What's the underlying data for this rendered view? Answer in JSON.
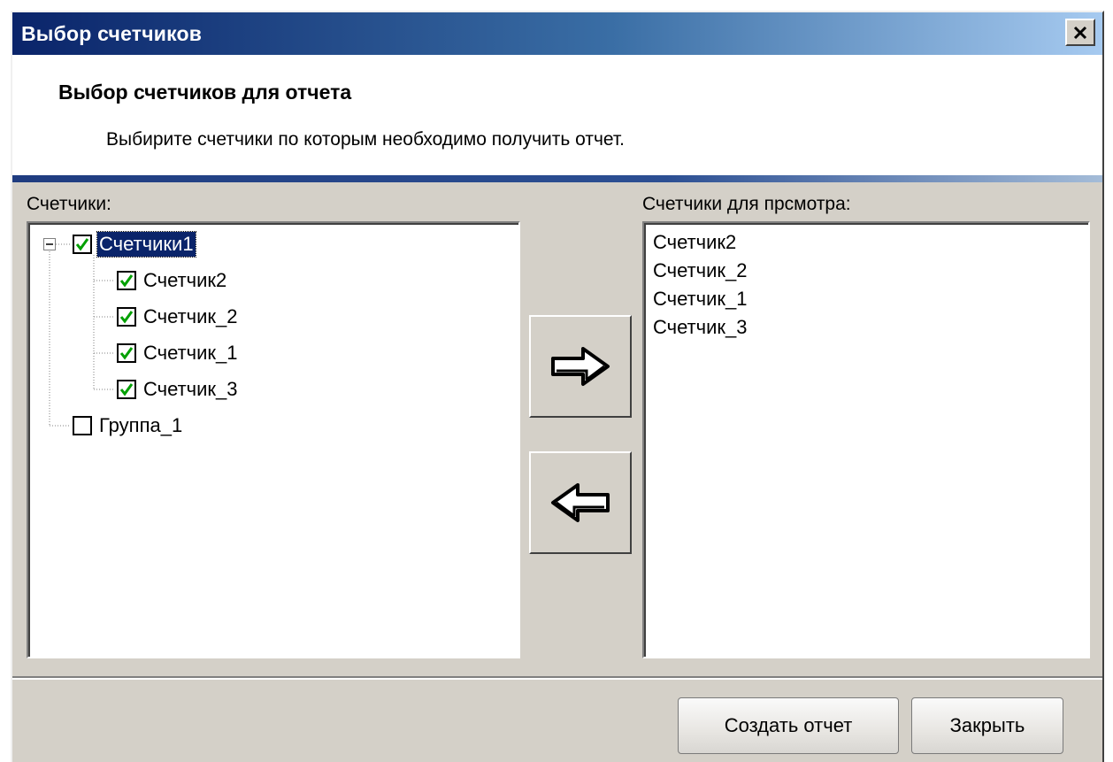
{
  "window": {
    "title": "Выбор счетчиков"
  },
  "header": {
    "title": "Выбор счетчиков для отчета",
    "description": "Выбирите счетчики по которым необходимо получить отчет."
  },
  "left_panel": {
    "label": "Счетчики:",
    "tree": [
      {
        "label": "Счетчики1",
        "checked": true,
        "expanded": true,
        "selected": true,
        "children": [
          {
            "label": "Счетчик2",
            "checked": true
          },
          {
            "label": "Счетчик_2",
            "checked": true
          },
          {
            "label": "Счетчик_1",
            "checked": true
          },
          {
            "label": "Счетчик_3",
            "checked": true
          }
        ]
      },
      {
        "label": "Группа_1",
        "checked": false
      }
    ]
  },
  "right_panel": {
    "label": "Счетчики для прсмотра:",
    "items": [
      "Счетчик2",
      "Счетчик_2",
      "Счетчик_1",
      "Счетчик_3"
    ]
  },
  "buttons": {
    "add_icon": "right-arrow-icon",
    "remove_icon": "left-arrow-icon",
    "create_report": "Создать отчет",
    "close": "Закрыть"
  },
  "colors": {
    "titlebar_start": "#0a246a",
    "titlebar_end": "#a6caf0",
    "dialog_bg": "#d4d0c8",
    "check_color": "#00a000"
  }
}
